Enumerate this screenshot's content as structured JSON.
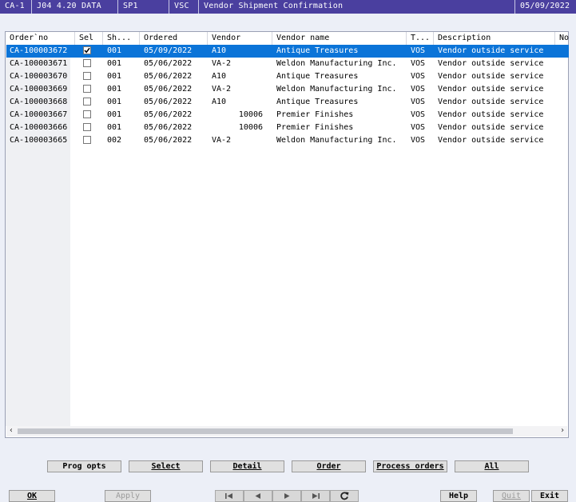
{
  "titlebar": {
    "company": "CA-1",
    "version": "J04 4.20 DATA",
    "menu": "SP1",
    "program": "VSC",
    "title": "Vendor Shipment Confirmation",
    "date": "05/09/2022"
  },
  "grid": {
    "columns": [
      "Order`no",
      "Sel",
      "Sh...",
      "Ordered",
      "Vendor",
      "Vendor name",
      "T...",
      "Description",
      "No"
    ],
    "rows": [
      {
        "order": "CA-100003672",
        "sel": true,
        "ship": "001",
        "ordered": "05/09/2022",
        "vendor": "A10",
        "vendor_right": "",
        "vendor_name": "Antique Treasures",
        "type": "VOS",
        "description": "Vendor outside service",
        "selected": true
      },
      {
        "order": "CA-100003671",
        "sel": false,
        "ship": "001",
        "ordered": "05/06/2022",
        "vendor": "VA-2",
        "vendor_right": "",
        "vendor_name": "Weldon Manufacturing Inc.",
        "type": "VOS",
        "description": "Vendor outside service",
        "selected": false
      },
      {
        "order": "CA-100003670",
        "sel": false,
        "ship": "001",
        "ordered": "05/06/2022",
        "vendor": "A10",
        "vendor_right": "",
        "vendor_name": "Antique Treasures",
        "type": "VOS",
        "description": "Vendor outside service",
        "selected": false
      },
      {
        "order": "CA-100003669",
        "sel": false,
        "ship": "001",
        "ordered": "05/06/2022",
        "vendor": "VA-2",
        "vendor_right": "",
        "vendor_name": "Weldon Manufacturing Inc.",
        "type": "VOS",
        "description": "Vendor outside service",
        "selected": false
      },
      {
        "order": "CA-100003668",
        "sel": false,
        "ship": "001",
        "ordered": "05/06/2022",
        "vendor": "A10",
        "vendor_right": "",
        "vendor_name": "Antique Treasures",
        "type": "VOS",
        "description": "Vendor outside service",
        "selected": false
      },
      {
        "order": "CA-100003667",
        "sel": false,
        "ship": "001",
        "ordered": "05/06/2022",
        "vendor": "",
        "vendor_right": "10006",
        "vendor_name": "Premier Finishes",
        "type": "VOS",
        "description": "Vendor outside service",
        "selected": false
      },
      {
        "order": "CA-100003666",
        "sel": false,
        "ship": "001",
        "ordered": "05/06/2022",
        "vendor": "",
        "vendor_right": "10006",
        "vendor_name": "Premier Finishes",
        "type": "VOS",
        "description": "Vendor outside service",
        "selected": false
      },
      {
        "order": "CA-100003665",
        "sel": false,
        "ship": "002",
        "ordered": "05/06/2022",
        "vendor": "VA-2",
        "vendor_right": "",
        "vendor_name": "Weldon Manufacturing Inc.",
        "type": "VOS",
        "description": "Vendor outside service",
        "selected": false
      }
    ]
  },
  "actions": {
    "prog_opts": "Prog opts",
    "select": "Select",
    "detail": "Detail",
    "order": "Order",
    "process_orders": "Process orders",
    "all": "All"
  },
  "bottom": {
    "ok": "OK",
    "apply": "Apply",
    "help": "Help",
    "quit": "Quit",
    "exit": "Exit"
  },
  "icons": {
    "first": "first-page-icon",
    "prev": "previous-page-icon",
    "next": "next-page-icon",
    "last": "last-page-icon",
    "refresh": "refresh-icon"
  },
  "colors": {
    "titlebar": "#4a3f9f",
    "selected_row": "#0b74d8",
    "background": "#eceff7"
  }
}
